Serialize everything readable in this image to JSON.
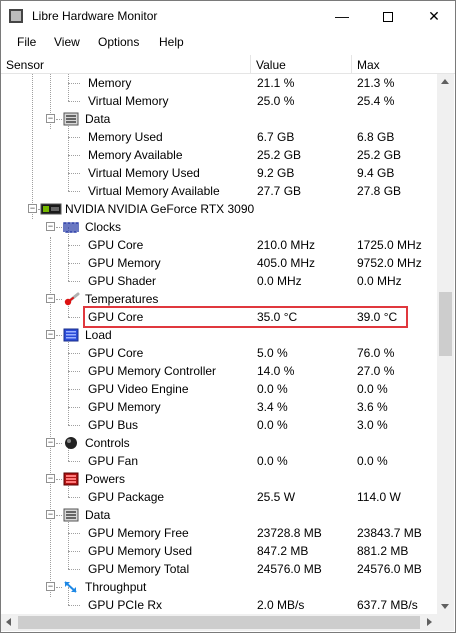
{
  "window": {
    "title": "Libre Hardware Monitor",
    "minimize_glyph": "—",
    "close_glyph": "✕"
  },
  "menu": [
    "File",
    "View",
    "Options",
    "Help"
  ],
  "columns": {
    "sensor": "Sensor",
    "value": "Value",
    "max": "Max"
  },
  "colors": {
    "highlight": "#e0383e"
  },
  "rows": [
    {
      "label": "Memory",
      "value": "21.1 %",
      "max": "21.3 %",
      "level": 3
    },
    {
      "label": "Virtual Memory",
      "value": "25.0 %",
      "max": "25.4 %",
      "level": 3
    },
    {
      "label": "Data",
      "value": "",
      "max": "",
      "level": 2,
      "icon": "data-icon",
      "expanded": true
    },
    {
      "label": "Memory Used",
      "value": "6.7 GB",
      "max": "6.8 GB",
      "level": 3
    },
    {
      "label": "Memory Available",
      "value": "25.2 GB",
      "max": "25.2 GB",
      "level": 3
    },
    {
      "label": "Virtual Memory Used",
      "value": "9.2 GB",
      "max": "9.4 GB",
      "level": 3
    },
    {
      "label": "Virtual Memory Available",
      "value": "27.7 GB",
      "max": "27.8 GB",
      "level": 3
    },
    {
      "label": "NVIDIA NVIDIA GeForce RTX 3090",
      "value": "",
      "max": "",
      "level": 1,
      "icon": "nvidia-gpu-icon",
      "expanded": true
    },
    {
      "label": "Clocks",
      "value": "",
      "max": "",
      "level": 2,
      "icon": "clock-icon",
      "expanded": true
    },
    {
      "label": "GPU Core",
      "value": "210.0 MHz",
      "max": "1725.0 MHz",
      "level": 3
    },
    {
      "label": "GPU Memory",
      "value": "405.0 MHz",
      "max": "9752.0 MHz",
      "level": 3
    },
    {
      "label": "GPU Shader",
      "value": "0.0 MHz",
      "max": "0.0 MHz",
      "level": 3
    },
    {
      "label": "Temperatures",
      "value": "",
      "max": "",
      "level": 2,
      "icon": "thermometer-icon",
      "expanded": true
    },
    {
      "label": "GPU Core",
      "value": "35.0 °C",
      "max": "39.0 °C",
      "level": 3,
      "highlighted": true
    },
    {
      "label": "Load",
      "value": "",
      "max": "",
      "level": 2,
      "icon": "load-icon",
      "expanded": true
    },
    {
      "label": "GPU Core",
      "value": "5.0 %",
      "max": "76.0 %",
      "level": 3
    },
    {
      "label": "GPU Memory Controller",
      "value": "14.0 %",
      "max": "27.0 %",
      "level": 3
    },
    {
      "label": "GPU Video Engine",
      "value": "0.0 %",
      "max": "0.0 %",
      "level": 3
    },
    {
      "label": "GPU Memory",
      "value": "3.4 %",
      "max": "3.6 %",
      "level": 3
    },
    {
      "label": "GPU Bus",
      "value": "0.0 %",
      "max": "3.0 %",
      "level": 3
    },
    {
      "label": "Controls",
      "value": "",
      "max": "",
      "level": 2,
      "icon": "fan-control-icon",
      "expanded": true
    },
    {
      "label": "GPU Fan",
      "value": "0.0 %",
      "max": "0.0 %",
      "level": 3
    },
    {
      "label": "Powers",
      "value": "",
      "max": "",
      "level": 2,
      "icon": "power-icon",
      "expanded": true
    },
    {
      "label": "GPU Package",
      "value": "25.5 W",
      "max": "114.0 W",
      "level": 3
    },
    {
      "label": "Data",
      "value": "",
      "max": "",
      "level": 2,
      "icon": "data-icon",
      "expanded": true
    },
    {
      "label": "GPU Memory Free",
      "value": "23728.8 MB",
      "max": "23843.7 MB",
      "level": 3
    },
    {
      "label": "GPU Memory Used",
      "value": "847.2 MB",
      "max": "881.2 MB",
      "level": 3
    },
    {
      "label": "GPU Memory Total",
      "value": "24576.0 MB",
      "max": "24576.0 MB",
      "level": 3
    },
    {
      "label": "Throughput",
      "value": "",
      "max": "",
      "level": 2,
      "icon": "throughput-icon",
      "expanded": true
    },
    {
      "label": "GPU PCIe Rx",
      "value": "2.0 MB/s",
      "max": "637.7 MB/s",
      "level": 3
    }
  ]
}
